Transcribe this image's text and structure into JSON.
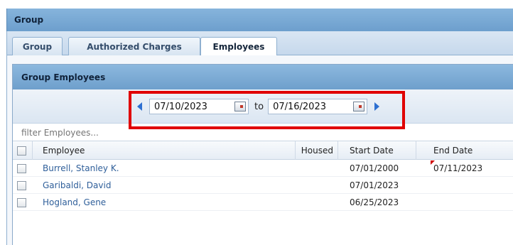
{
  "panel": {
    "title": "Group"
  },
  "tabs": [
    {
      "label": "Group",
      "active": false
    },
    {
      "label": "Authorized Charges",
      "active": false
    },
    {
      "label": "Employees",
      "active": true
    }
  ],
  "grid": {
    "title": "Group Employees",
    "date_range": {
      "from": "07/10/2023",
      "to_label": "to",
      "to": "07/16/2023"
    },
    "filter_placeholder": "filter Employees...",
    "columns": [
      "Employee",
      "Housed",
      "Start Date",
      "End Date"
    ],
    "rows": [
      {
        "employee": "Burrell, Stanley K.",
        "housed": "",
        "start_date": "07/01/2000",
        "end_date": "07/11/2023"
      },
      {
        "employee": "Garibaldi, David",
        "housed": "",
        "start_date": "07/01/2023",
        "end_date": ""
      },
      {
        "employee": "Hogland, Gene",
        "housed": "",
        "start_date": "06/25/2023",
        "end_date": ""
      }
    ]
  },
  "colors": {
    "highlight": "#e00000",
    "header_blue": "#7aaad5",
    "link": "#2f5f9a"
  }
}
